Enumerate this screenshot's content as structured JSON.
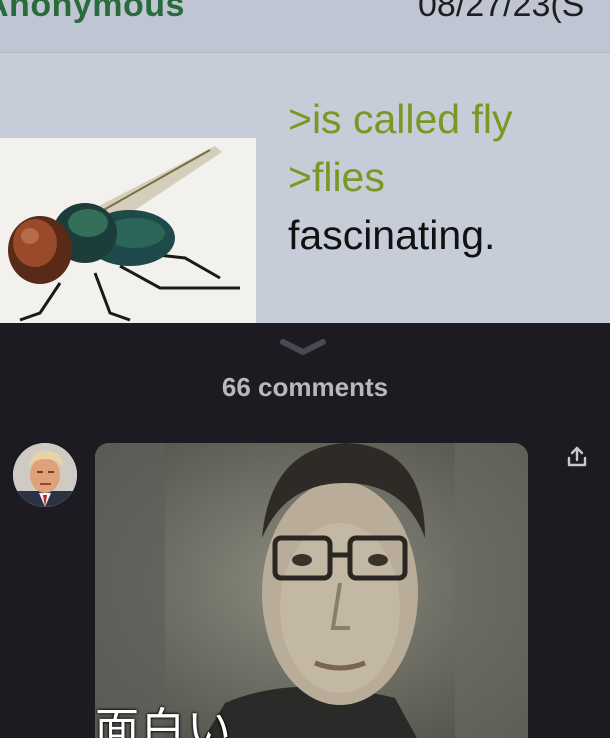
{
  "post": {
    "poster_name": "Anonymous",
    "date": "08/27/23(S",
    "lines": {
      "greentext_1": ">is called fly",
      "greentext_2": ">flies",
      "text_3": "fascinating."
    }
  },
  "comments_section": {
    "count_label": "66 comments"
  },
  "comment": {
    "image_caption": "面白い"
  },
  "icons": {
    "collapse": "chevron-down-icon",
    "share": "share-icon"
  },
  "colors": {
    "background": "#1c1b22",
    "greentext": "#789922",
    "name_green": "#2a6b3b",
    "post_bg": "#c7ccd9",
    "comment_count": "#b9b8bf"
  }
}
